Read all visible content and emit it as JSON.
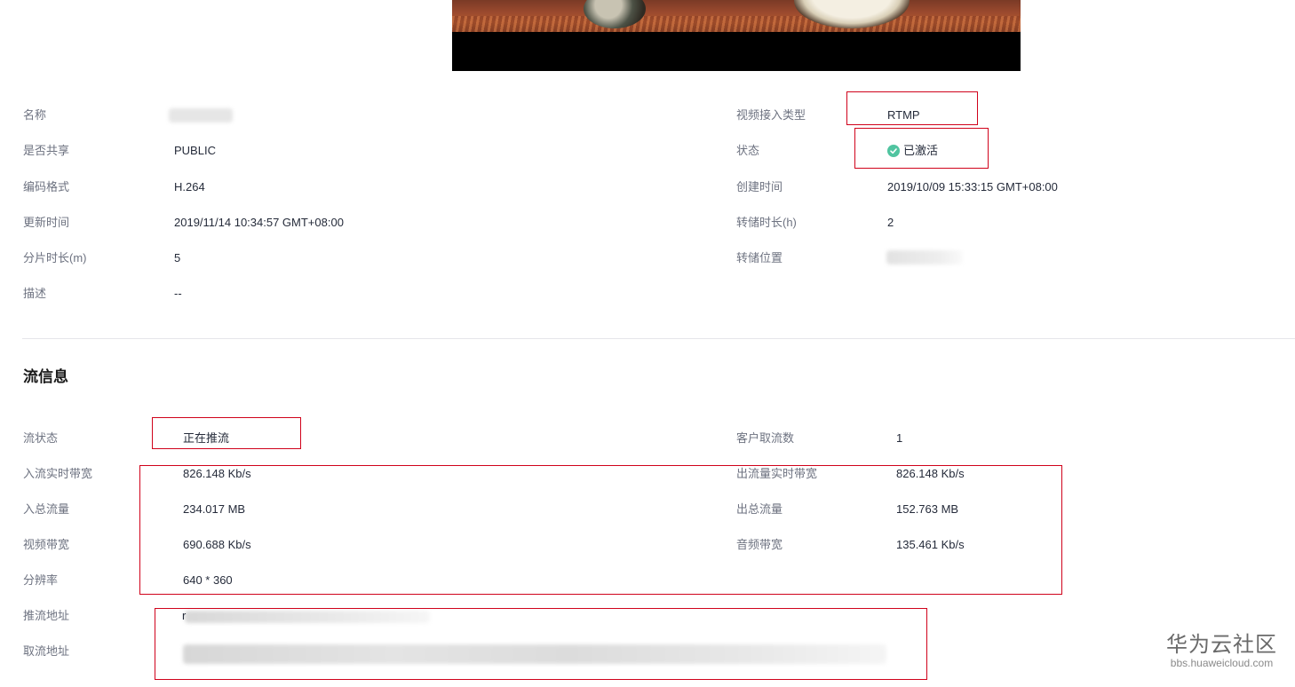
{
  "details": {
    "name_label": "名称",
    "share_label": "是否共享",
    "share_value": "PUBLIC",
    "codec_label": "编码格式",
    "codec_value": "H.264",
    "updated_label": "更新时间",
    "updated_value": "2019/11/14 10:34:57 GMT+08:00",
    "segment_label": "分片时长(m)",
    "segment_value": "5",
    "desc_label": "描述",
    "desc_value": "--",
    "access_type_label": "视频接入类型",
    "access_type_value": "RTMP",
    "status_label": "状态",
    "status_value": "已激活",
    "created_label": "创建时间",
    "created_value": "2019/10/09 15:33:15 GMT+08:00",
    "storage_duration_label": "转储时长(h)",
    "storage_duration_value": "2",
    "storage_location_label": "转储位置"
  },
  "stream": {
    "title": "流信息",
    "state_label": "流状态",
    "state_value": "正在推流",
    "clients_label": "客户取流数",
    "clients_value": "1",
    "in_bw_label": "入流实时带宽",
    "in_bw_value": "826.148 Kb/s",
    "out_bw_label": "出流量实时带宽",
    "out_bw_value": "826.148 Kb/s",
    "in_total_label": "入总流量",
    "in_total_value": "234.017 MB",
    "out_total_label": "出总流量",
    "out_total_value": "152.763 MB",
    "video_bw_label": "视频带宽",
    "video_bw_value": "690.688 Kb/s",
    "audio_bw_label": "音频带宽",
    "audio_bw_value": "135.461 Kb/s",
    "resolution_label": "分辨率",
    "resolution_value": "640 * 360",
    "push_url_label": "推流地址",
    "push_url_visible": "r",
    "pull_url_label": "取流地址"
  },
  "watermark": {
    "title": "华为云社区",
    "url": "bbs.huaweicloud.com"
  },
  "colors": {
    "highlight": "#d0021b",
    "status_ok": "#50c4a0"
  },
  "icons": {
    "status": "check-circle-icon"
  }
}
